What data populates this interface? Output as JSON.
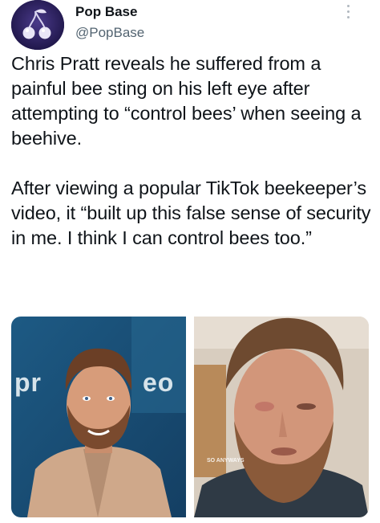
{
  "tweet": {
    "author_name": "Pop Base",
    "author_handle": "@PopBase",
    "text": "Chris Pratt reveals he suffered from a painful bee sting on his left eye after attempting to “control bees’ when seeing a beehive.\n\nAfter viewing a popular TikTok beekeeper’s video, it “built up this false sense of security in me. I think I can control bees too.”"
  },
  "media": {
    "left_overlay_a": "pr",
    "left_overlay_b": "eo",
    "right_caption": "SO ANYWAYS"
  },
  "icons": {
    "avatar": "cherries-logo-icon",
    "more": "more-vertical-icon"
  },
  "colors": {
    "avatar_bg": "#2a1f5e",
    "text": "#0f1419",
    "handle": "#536471",
    "left_photo_bg": "#1f5b86"
  }
}
